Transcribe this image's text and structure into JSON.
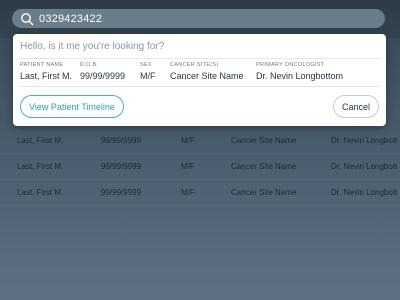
{
  "search": {
    "query": "0329423422",
    "icon": "search-icon"
  },
  "popup": {
    "prompt": "Hello, is it me you're looking for?",
    "headers": {
      "name": "PATIENT NAME",
      "dob": "D.O.B.",
      "sex": "SEX",
      "site": "CANCER SITE(S)",
      "oncologist": "PRIMARY ONCOLOGIST"
    },
    "result": {
      "name": "Last, First M.",
      "dob": "99/99/9999",
      "sex": "M/F",
      "site": "Cancer Site Name",
      "oncologist": "Dr. Nevin Longbottom"
    },
    "timeline_button": "View Patient Timeline",
    "cancel_button": "Cancel"
  },
  "rows": [
    {
      "name": "Last, First M.",
      "dob": "99/99/9999",
      "sex": "M/F",
      "site": "Cancer Site Name",
      "oncologist": "Dr. Nevin Longbott"
    },
    {
      "name": "Last, First M.",
      "dob": "99/99/9999",
      "sex": "M/F",
      "site": "Cancer Site Name",
      "oncologist": "Dr. Nevin Longbott"
    },
    {
      "name": "Last, First M.",
      "dob": "99/99/9999",
      "sex": "M/F",
      "site": "Cancer Site Name",
      "oncologist": "Dr. Nevin Longbott"
    }
  ],
  "colors": {
    "accent": "#3fb4c8",
    "search_bg": "#6a7d8b"
  }
}
